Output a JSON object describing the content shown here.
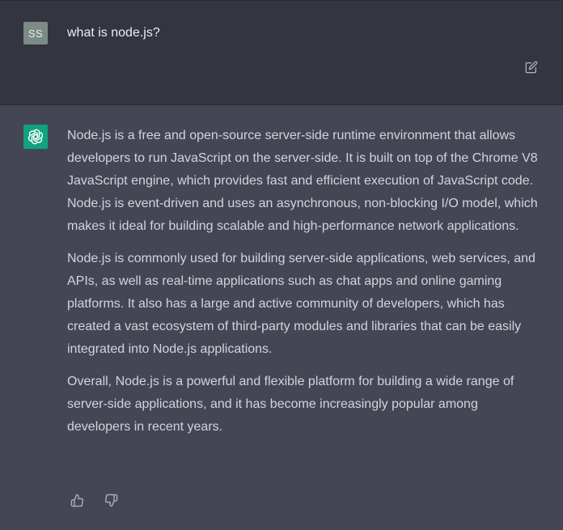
{
  "user": {
    "avatar_initials": "SS",
    "message": "what is node.js?",
    "edit_icon": "edit-icon"
  },
  "assistant": {
    "avatar_icon": "openai-logo-icon",
    "paragraphs": [
      "Node.js is a free and open-source server-side runtime environment that allows developers to run JavaScript on the server-side. It is built on top of the Chrome V8 JavaScript engine, which provides fast and efficient execution of JavaScript code. Node.js is event-driven and uses an asynchronous, non-blocking I/O model, which makes it ideal for building scalable and high-performance network applications.",
      "Node.js is commonly used for building server-side applications, web services, and APIs, as well as real-time applications such as chat apps and online gaming platforms. It also has a large and active community of developers, which has created a vast ecosystem of third-party modules and libraries that can be easily integrated into Node.js applications.",
      "Overall, Node.js is a powerful and flexible platform for building a wide range of server-side applications, and it has become increasingly popular among developers in recent years."
    ],
    "feedback": {
      "thumbs_up_icon": "thumbs-up-icon",
      "thumbs_down_icon": "thumbs-down-icon"
    }
  },
  "colors": {
    "user_bg": "#343541",
    "assistant_bg": "#444654",
    "user_avatar_bg": "#7d8b86",
    "assistant_avatar_bg": "#10a37f",
    "text": "#d1d5db"
  }
}
